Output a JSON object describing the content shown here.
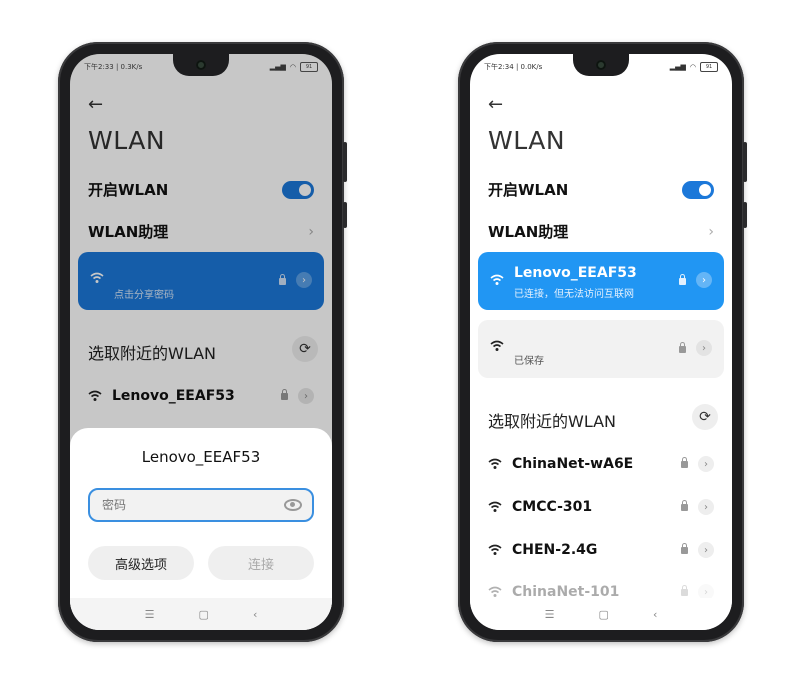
{
  "colors": {
    "accent": "#1c78d9",
    "accent_light": "#2196f3",
    "bg": "#ffffff"
  },
  "left_phone": {
    "status": {
      "time_speed": "下午2:33 | 0.3K/s",
      "alarm_icon": "alarm-icon",
      "battery": "91"
    },
    "title": "WLAN",
    "enable_wlan_label": "开启WLAN",
    "wlan_assistant_label": "WLAN助理",
    "connected_card": {
      "subtitle": "点击分享密码"
    },
    "nearby_section_title": "选取附近的WLAN",
    "networks": [
      {
        "name": "Lenovo_EEAF53"
      }
    ],
    "dialog": {
      "title": "Lenovo_EEAF53",
      "password_placeholder": "密码",
      "advanced_label": "高级选项",
      "connect_label": "连接"
    }
  },
  "right_phone": {
    "status": {
      "time_speed": "下午2:34 | 0.0K/s",
      "alarm_icon": "alarm-icon",
      "battery": "91"
    },
    "title": "WLAN",
    "enable_wlan_label": "开启WLAN",
    "wlan_assistant_label": "WLAN助理",
    "connected_card": {
      "title": "Lenovo_EEAF53",
      "subtitle": "已连接，但无法访问互联网"
    },
    "saved_card": {
      "subtitle": "已保存"
    },
    "nearby_section_title": "选取附近的WLAN",
    "networks": [
      {
        "name": "ChinaNet-wA6E"
      },
      {
        "name": "CMCC-301"
      },
      {
        "name": "CHEN-2.4G"
      },
      {
        "name": "ChinaNet-101"
      }
    ]
  },
  "nav": {
    "menu": "☰",
    "home": "▢",
    "back": "‹"
  }
}
